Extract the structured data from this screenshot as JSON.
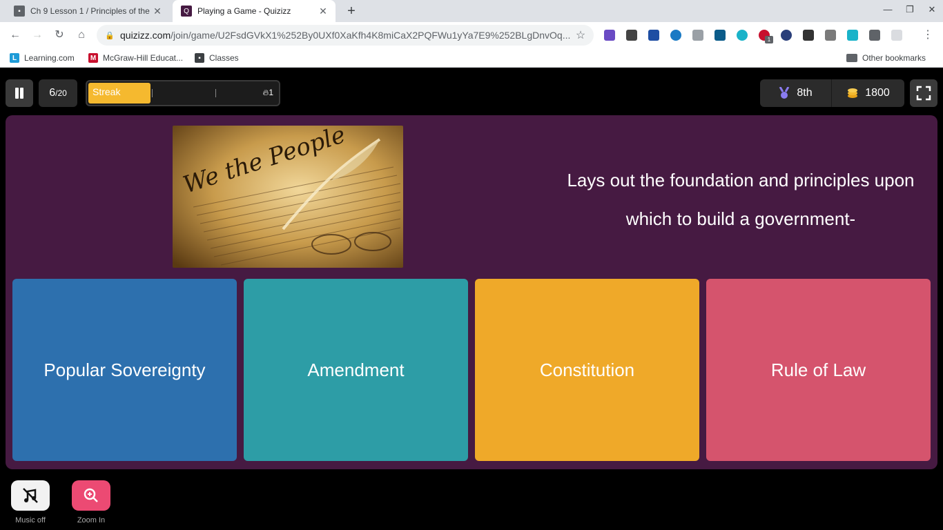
{
  "browser": {
    "tabs": [
      {
        "title": "Ch 9 Lesson 1 / Principles of the",
        "favicon_color": "#3c4043"
      },
      {
        "title": "Playing a Game - Quizizz",
        "favicon_color": "#461a42"
      }
    ],
    "url_domain": "quizizz.com",
    "url_path": "/join/game/U2FsdGVkX1%252By0UXf0XaKfh4K8miCaX2PQFWu1yYa7E9%252BLgDnvOq...",
    "bookmarks": [
      {
        "label": "Learning.com",
        "icon": "learning-icon",
        "color": "#1e9bd7"
      },
      {
        "label": "McGraw-Hill Educat...",
        "icon": "mcgraw-hill-icon",
        "color": "#c8102e"
      },
      {
        "label": "Classes",
        "icon": "classes-icon",
        "color": "#3c4043"
      }
    ],
    "other_bookmarks": "Other bookmarks",
    "extension_badge": "1"
  },
  "game": {
    "question_current": "6",
    "question_total": "/20",
    "streak_label": "Streak",
    "streak_fill_fraction": 0.33,
    "streak_count": "1",
    "rank": "8th",
    "coins": "1800",
    "question_text": "Lays out the foundation and principles upon which to build a government-",
    "image_text": "We the People",
    "answers": [
      {
        "label": "Popular Sovereignty",
        "color": "#2d70ae"
      },
      {
        "label": "Amendment",
        "color": "#2d9da6"
      },
      {
        "label": "Constitution",
        "color": "#efa929"
      },
      {
        "label": "Rule of Law",
        "color": "#d5546d"
      }
    ],
    "panel_color": "#461a42",
    "controls": {
      "music_label": "Music off",
      "zoom_label": "Zoom In"
    }
  }
}
